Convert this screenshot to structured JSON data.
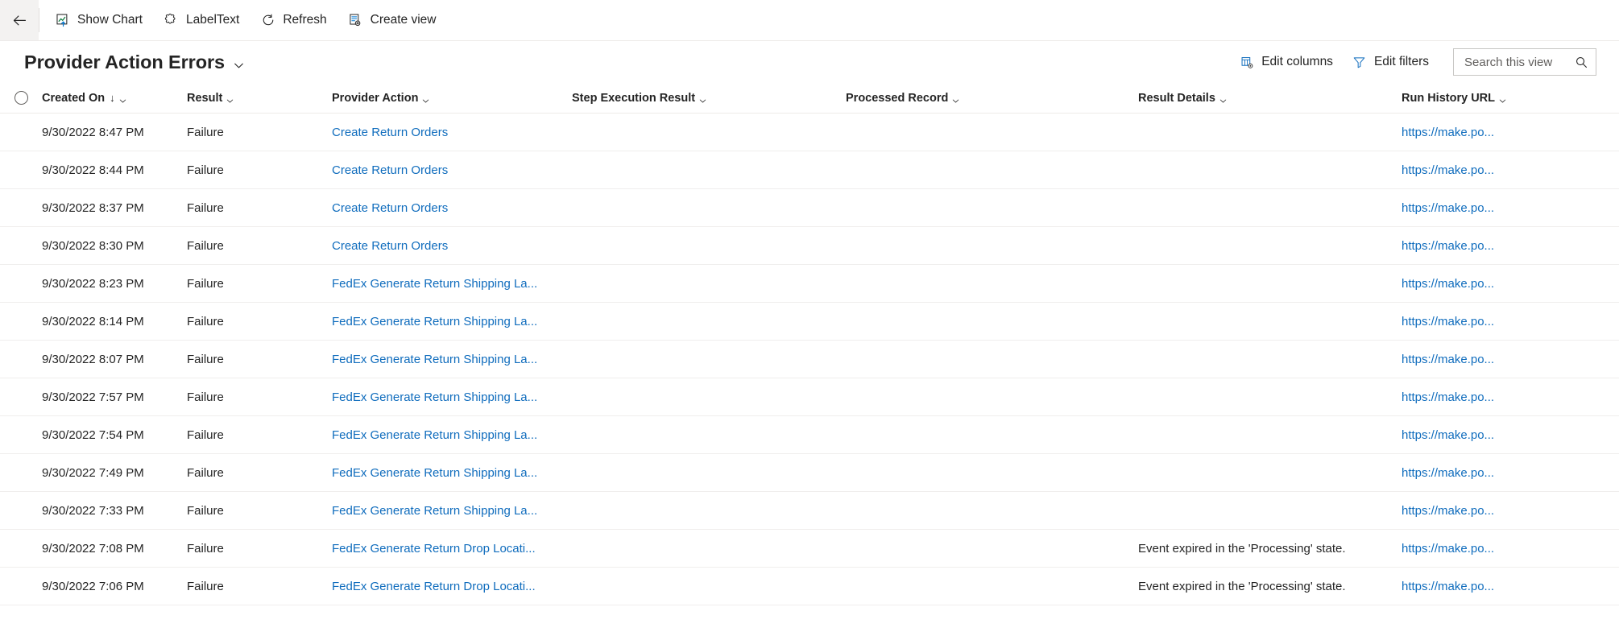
{
  "command_bar": {
    "back_label": "Back",
    "buttons": [
      {
        "id": "show-chart",
        "label": "Show Chart",
        "icon": "chart-icon"
      },
      {
        "id": "label-text",
        "label": "LabelText",
        "icon": "puzzle-icon"
      },
      {
        "id": "refresh",
        "label": "Refresh",
        "icon": "refresh-icon"
      },
      {
        "id": "create-view",
        "label": "Create view",
        "icon": "create-view-icon"
      }
    ]
  },
  "view_header": {
    "title": "Provider Action Errors",
    "edit_columns_label": "Edit columns",
    "edit_filters_label": "Edit filters",
    "search_placeholder": "Search this view",
    "search_value": ""
  },
  "grid": {
    "columns": [
      {
        "key": "created_on",
        "label": "Created On",
        "sorted": true,
        "sort_dir": "asc"
      },
      {
        "key": "result",
        "label": "Result",
        "sorted": false
      },
      {
        "key": "provider_action",
        "label": "Provider Action",
        "sorted": false
      },
      {
        "key": "step_execution",
        "label": "Step Execution Result",
        "sorted": false
      },
      {
        "key": "processed",
        "label": "Processed Record",
        "sorted": false
      },
      {
        "key": "result_details",
        "label": "Result Details",
        "sorted": false
      },
      {
        "key": "run_history",
        "label": "Run History URL",
        "sorted": false
      }
    ],
    "rows": [
      {
        "created_on": "9/30/2022 8:47 PM",
        "result": "Failure",
        "provider_action": "Create Return Orders",
        "step_execution": "",
        "processed": "",
        "result_details": "",
        "run_history": "https://make.po..."
      },
      {
        "created_on": "9/30/2022 8:44 PM",
        "result": "Failure",
        "provider_action": "Create Return Orders",
        "step_execution": "",
        "processed": "",
        "result_details": "",
        "run_history": "https://make.po..."
      },
      {
        "created_on": "9/30/2022 8:37 PM",
        "result": "Failure",
        "provider_action": "Create Return Orders",
        "step_execution": "",
        "processed": "",
        "result_details": "",
        "run_history": "https://make.po..."
      },
      {
        "created_on": "9/30/2022 8:30 PM",
        "result": "Failure",
        "provider_action": "Create Return Orders",
        "step_execution": "",
        "processed": "",
        "result_details": "",
        "run_history": "https://make.po..."
      },
      {
        "created_on": "9/30/2022 8:23 PM",
        "result": "Failure",
        "provider_action": "FedEx Generate Return Shipping La...",
        "step_execution": "",
        "processed": "",
        "result_details": "",
        "run_history": "https://make.po..."
      },
      {
        "created_on": "9/30/2022 8:14 PM",
        "result": "Failure",
        "provider_action": "FedEx Generate Return Shipping La...",
        "step_execution": "",
        "processed": "",
        "result_details": "",
        "run_history": "https://make.po..."
      },
      {
        "created_on": "9/30/2022 8:07 PM",
        "result": "Failure",
        "provider_action": "FedEx Generate Return Shipping La...",
        "step_execution": "",
        "processed": "",
        "result_details": "",
        "run_history": "https://make.po..."
      },
      {
        "created_on": "9/30/2022 7:57 PM",
        "result": "Failure",
        "provider_action": "FedEx Generate Return Shipping La...",
        "step_execution": "",
        "processed": "",
        "result_details": "",
        "run_history": "https://make.po..."
      },
      {
        "created_on": "9/30/2022 7:54 PM",
        "result": "Failure",
        "provider_action": "FedEx Generate Return Shipping La...",
        "step_execution": "",
        "processed": "",
        "result_details": "",
        "run_history": "https://make.po..."
      },
      {
        "created_on": "9/30/2022 7:49 PM",
        "result": "Failure",
        "provider_action": "FedEx Generate Return Shipping La...",
        "step_execution": "",
        "processed": "",
        "result_details": "",
        "run_history": "https://make.po..."
      },
      {
        "created_on": "9/30/2022 7:33 PM",
        "result": "Failure",
        "provider_action": "FedEx Generate Return Shipping La...",
        "step_execution": "",
        "processed": "",
        "result_details": "",
        "run_history": "https://make.po..."
      },
      {
        "created_on": "9/30/2022 7:08 PM",
        "result": "Failure",
        "provider_action": "FedEx Generate Return Drop Locati...",
        "step_execution": "",
        "processed": "",
        "result_details": "Event expired in the 'Processing' state.",
        "run_history": "https://make.po..."
      },
      {
        "created_on": "9/30/2022 7:06 PM",
        "result": "Failure",
        "provider_action": "FedEx Generate Return Drop Locati...",
        "step_execution": "",
        "processed": "",
        "result_details": "Event expired in the 'Processing' state.",
        "run_history": "https://make.po..."
      }
    ]
  },
  "colors": {
    "link": "#0f6cbd",
    "text": "#242424",
    "border": "#edebe9",
    "accent": "#0078d4"
  }
}
